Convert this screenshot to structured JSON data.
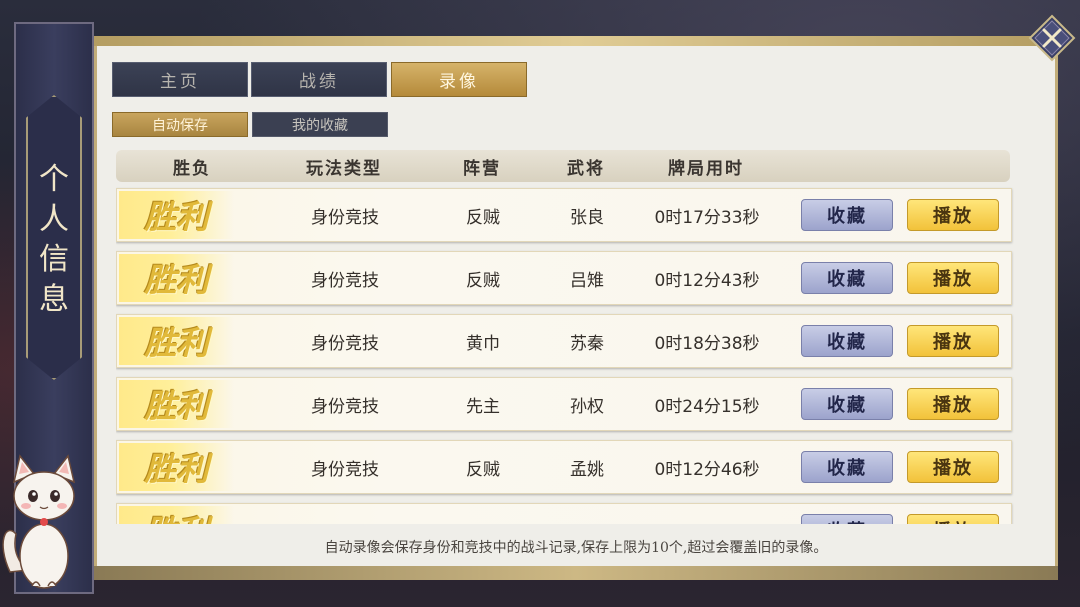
{
  "side_title": "个人信息",
  "tabs": [
    {
      "label": "主页",
      "active": false
    },
    {
      "label": "战绩",
      "active": false
    },
    {
      "label": "录像",
      "active": true
    }
  ],
  "subtabs": [
    {
      "label": "自动保存",
      "active": true
    },
    {
      "label": "我的收藏",
      "active": false
    }
  ],
  "columns": [
    "胜负",
    "玩法类型",
    "阵营",
    "武将",
    "牌局用时"
  ],
  "rows": [
    {
      "result": "胜利",
      "mode": "身份竞技",
      "camp": "反贼",
      "general": "张良",
      "time": "0时17分33秒",
      "fav": "收藏",
      "play": "播放"
    },
    {
      "result": "胜利",
      "mode": "身份竞技",
      "camp": "反贼",
      "general": "吕雉",
      "time": "0时12分43秒",
      "fav": "收藏",
      "play": "播放"
    },
    {
      "result": "胜利",
      "mode": "身份竞技",
      "camp": "黄巾",
      "general": "苏秦",
      "time": "0时18分38秒",
      "fav": "收藏",
      "play": "播放"
    },
    {
      "result": "胜利",
      "mode": "身份竞技",
      "camp": "先主",
      "general": "孙权",
      "time": "0时24分15秒",
      "fav": "收藏",
      "play": "播放"
    },
    {
      "result": "胜利",
      "mode": "身份竞技",
      "camp": "反贼",
      "general": "孟姚",
      "time": "0时12分46秒",
      "fav": "收藏",
      "play": "播放"
    },
    {
      "result": "胜利",
      "mode": "",
      "camp": "",
      "general": "",
      "time": "",
      "fav": "收藏",
      "play": "播放"
    }
  ],
  "footer_note": "自动录像会保存身份和竞技中的战斗记录,保存上限为10个,超过会覆盖旧的录像。",
  "colors": {
    "accent_gold": "#d6b36a",
    "panel_bg": "#efeee9",
    "win_gold": "#e1b93a",
    "fav_blue": "#9ca3cc",
    "play_yellow": "#f2c23a"
  },
  "icons": [
    "close-icon",
    "mascot-fox-icon"
  ]
}
